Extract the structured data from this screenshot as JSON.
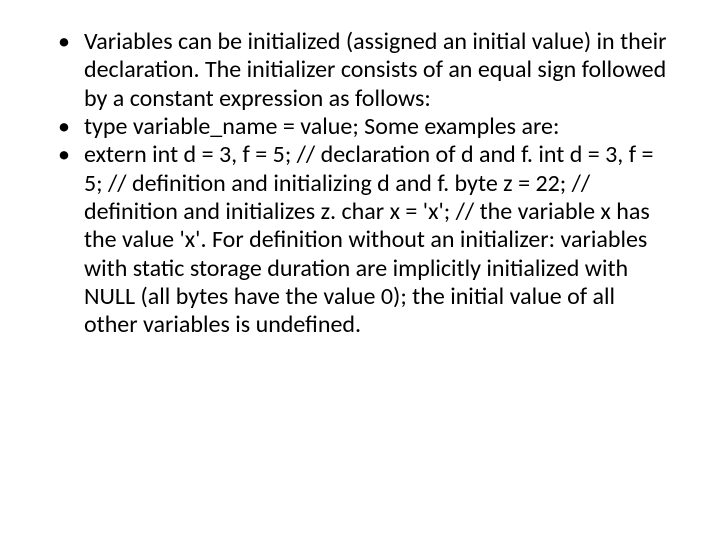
{
  "bullets": [
    "Variables can be initialized (assigned an initial value) in their declaration. The initializer consists of an equal sign followed by a constant expression as follows:",
    "type variable_name = value; Some examples are:",
    "extern int d = 3, f = 5; // declaration of d and f. int d = 3, f = 5; // definition and initializing d and f. byte z = 22; // definition and initializes z. char x = 'x'; // the variable x has the value 'x'. For definition without an initializer: variables with static storage duration are implicitly initialized with NULL (all bytes have the value 0); the initial value of all other variables is undefined."
  ]
}
